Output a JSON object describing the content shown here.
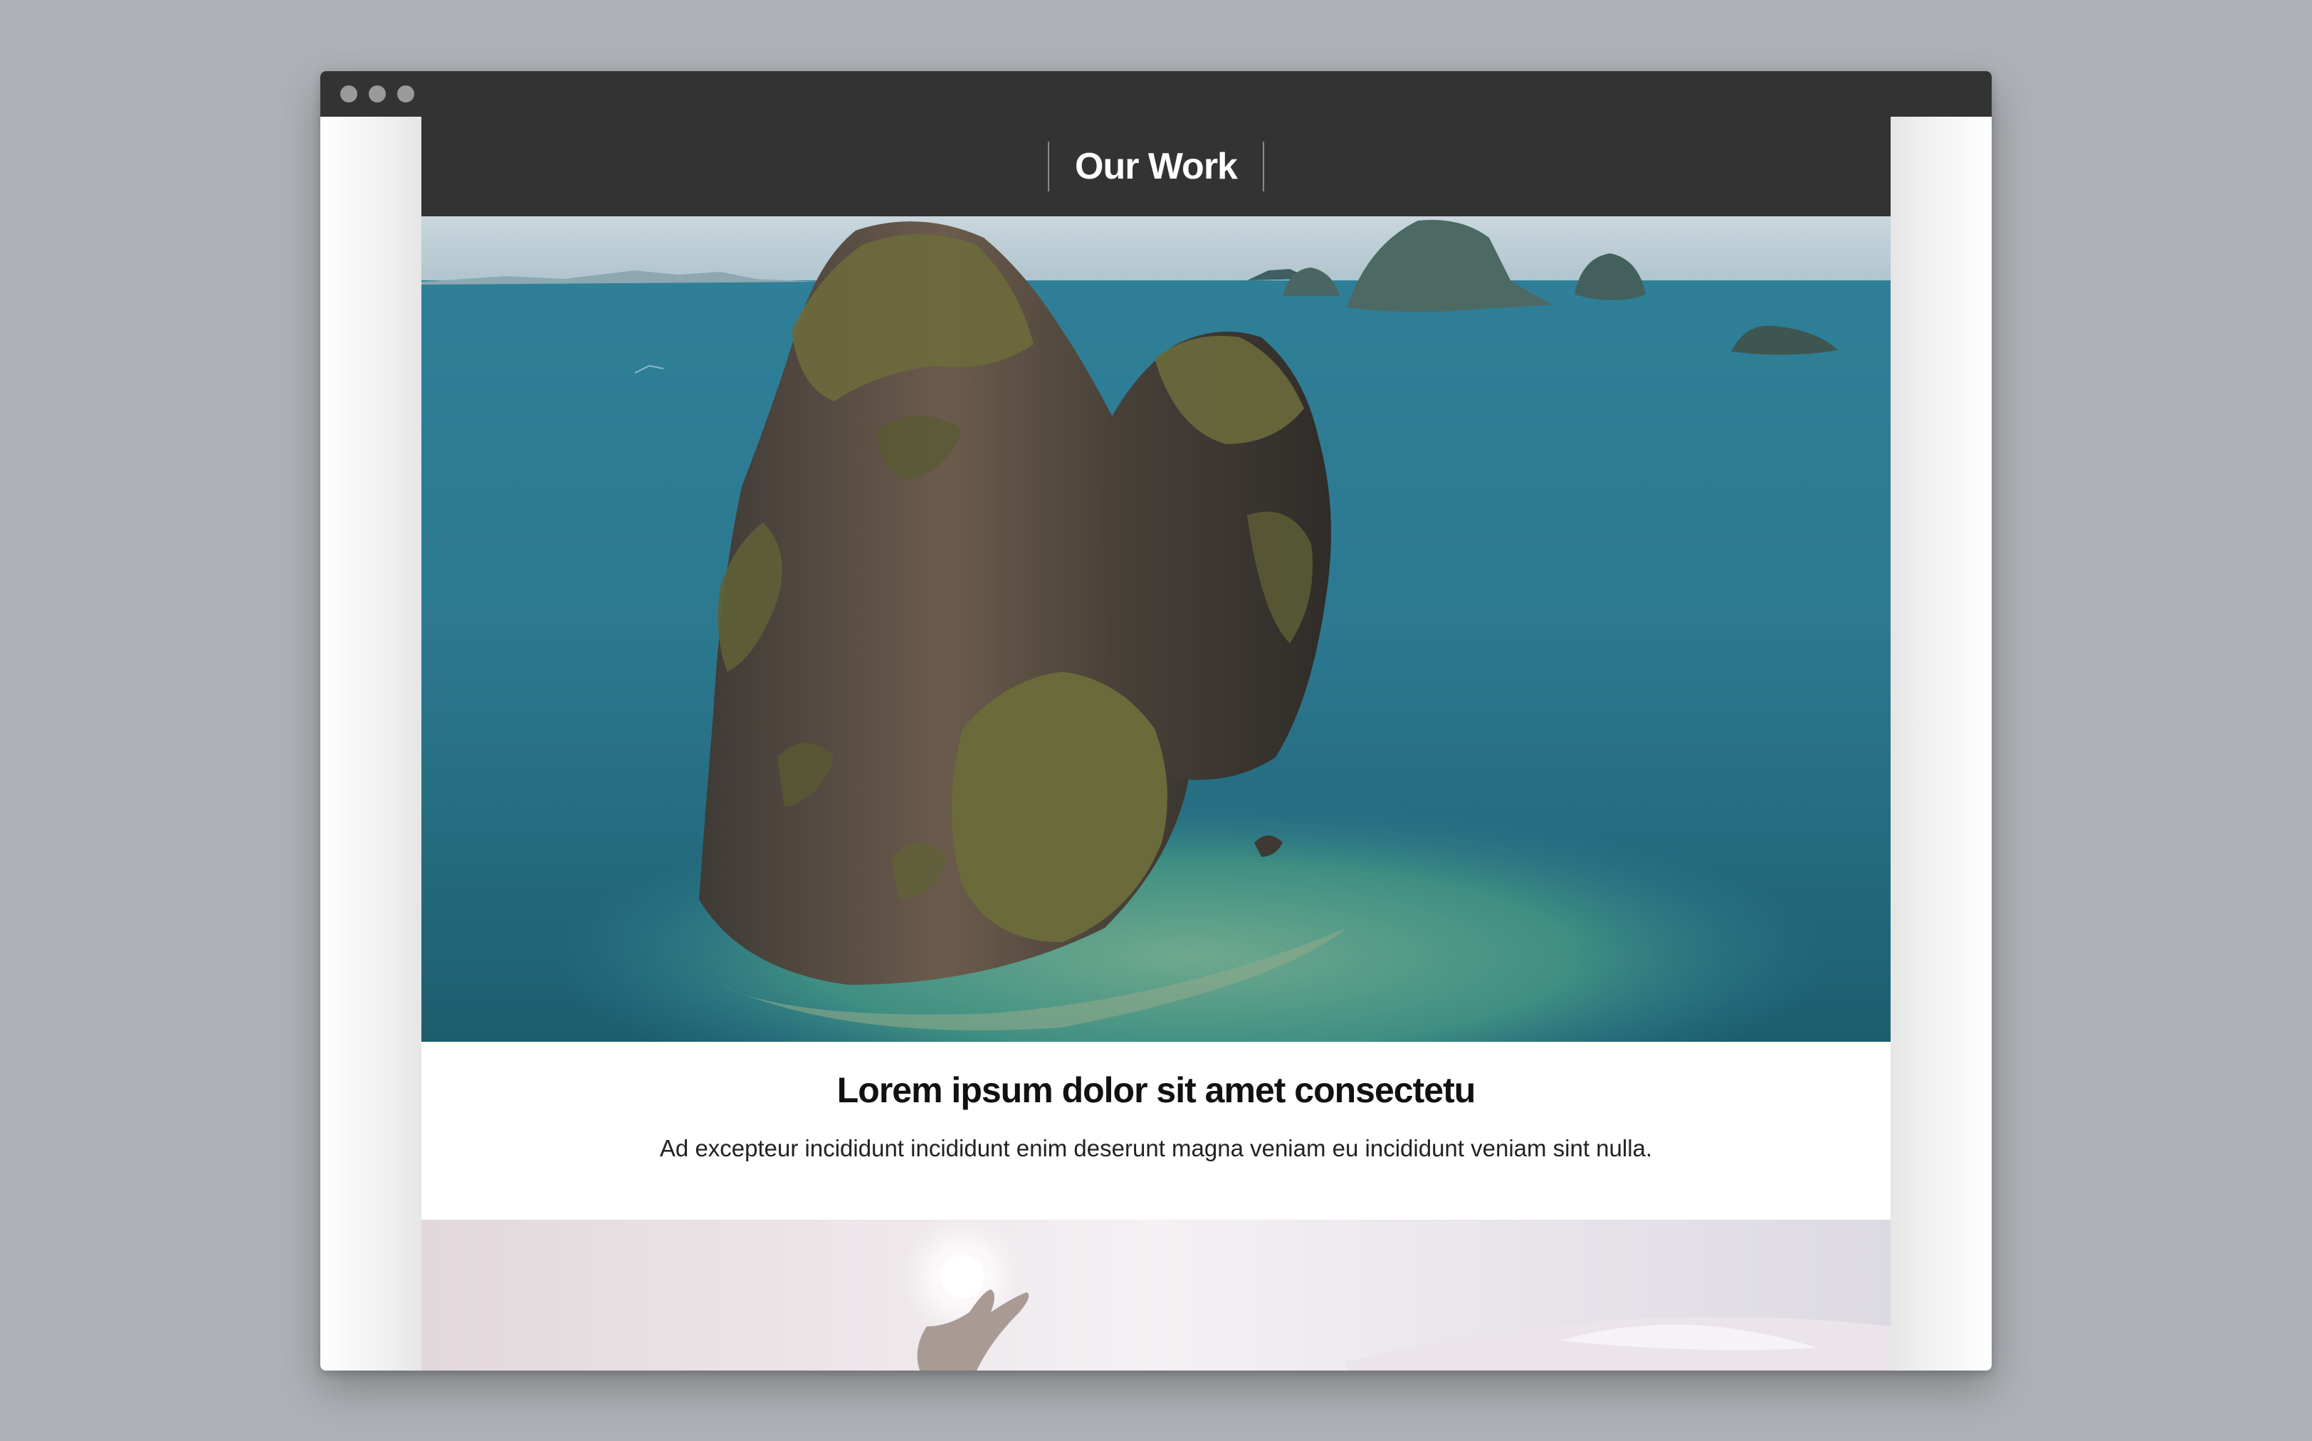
{
  "window": {
    "controls": [
      "close",
      "minimize",
      "maximize"
    ]
  },
  "header": {
    "title": "Our Work"
  },
  "hero_image": {
    "subject": "limestone-karst-islands-in-turquoise-sea"
  },
  "card": {
    "title": "Lorem ipsum dolor sit amet consectetu",
    "body": "Ad excepteur incididunt incididunt enim deserunt magna veniam eu incididunt veniam sint nulla."
  },
  "second_image": {
    "subject": "hand-reaching-toward-sun-in-pale-sky"
  },
  "colors": {
    "backdrop": "#aeb2b6",
    "chrome": "#333333",
    "header_bg": "#333333",
    "header_text": "#ffffff",
    "title_text": "#111111",
    "body_text": "#222222"
  }
}
